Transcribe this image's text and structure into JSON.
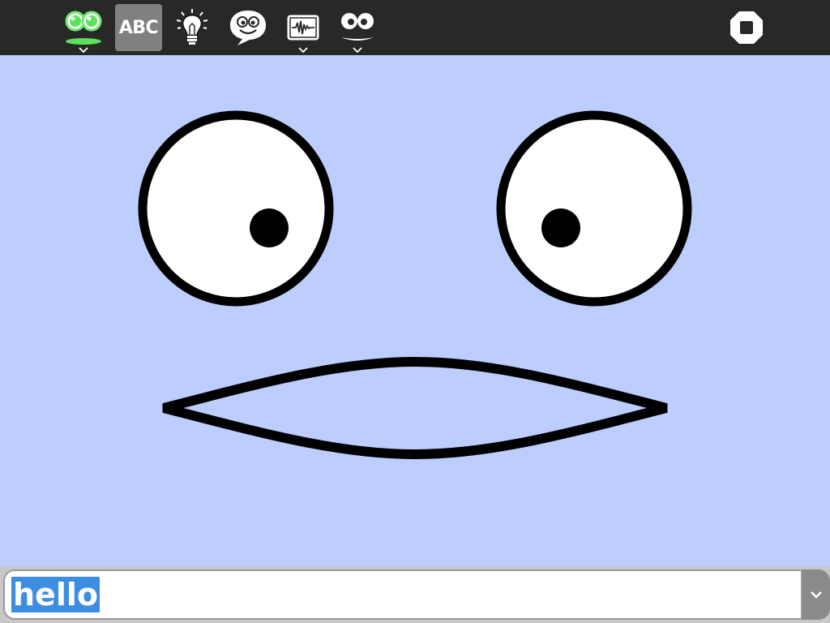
{
  "toolbar": {
    "tools": [
      {
        "icon": "activity-face-icon",
        "has_menu": true,
        "active": false
      },
      {
        "icon": "abc-speak-icon",
        "label": "ABC",
        "has_menu": false,
        "active": true
      },
      {
        "icon": "lightbulb-icon",
        "has_menu": false,
        "active": false
      },
      {
        "icon": "chat-bubble-icon",
        "has_menu": false,
        "active": false
      },
      {
        "icon": "waveform-icon",
        "has_menu": true,
        "active": false
      },
      {
        "icon": "face-settings-icon",
        "has_menu": true,
        "active": false
      }
    ],
    "stop_icon": "stop-icon"
  },
  "face": {
    "background": "#bdcdfd",
    "outline": "#000000",
    "eye_color": "#ffffff"
  },
  "entry": {
    "value": "hello",
    "selected": true,
    "dropdown_icon": "chevron-down-icon"
  }
}
